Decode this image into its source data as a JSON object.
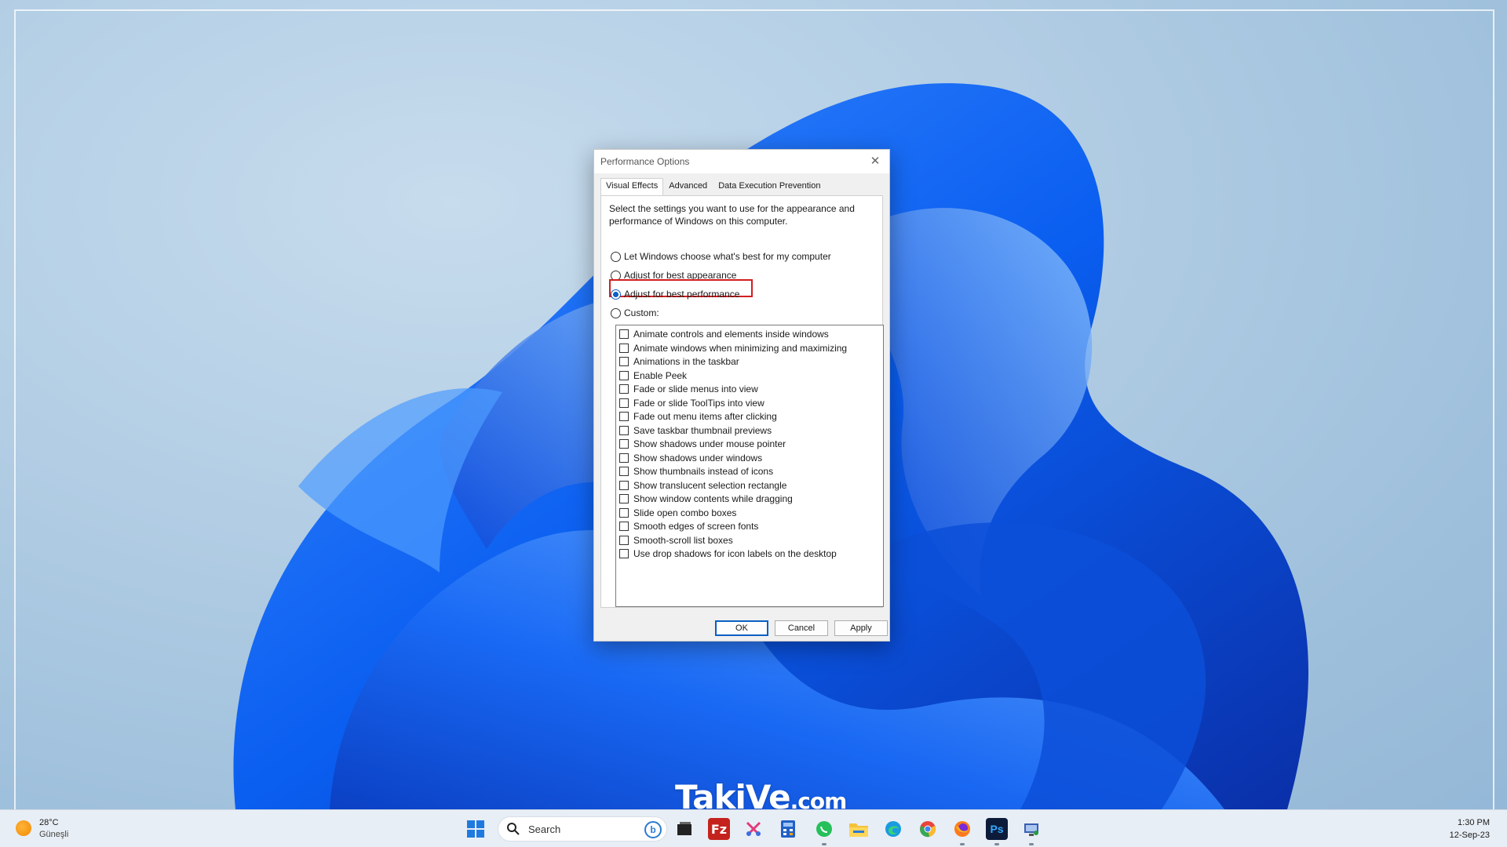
{
  "dialog": {
    "title": "Performance Options",
    "tabs": [
      {
        "label": "Visual Effects",
        "active": true
      },
      {
        "label": "Advanced",
        "active": false
      },
      {
        "label": "Data Execution Prevention",
        "active": false
      }
    ],
    "description": "Select the settings you want to use for the appearance and performance of Windows on this computer.",
    "radios": [
      {
        "label": "Let Windows choose what's best for my computer",
        "checked": false
      },
      {
        "label": "Adjust for best appearance",
        "checked": false
      },
      {
        "label": "Adjust for best performance",
        "checked": true
      },
      {
        "label": "Custom:",
        "checked": false
      }
    ],
    "effects": [
      "Animate controls and elements inside windows",
      "Animate windows when minimizing and maximizing",
      "Animations in the taskbar",
      "Enable Peek",
      "Fade or slide menus into view",
      "Fade or slide ToolTips into view",
      "Fade out menu items after clicking",
      "Save taskbar thumbnail previews",
      "Show shadows under mouse pointer",
      "Show shadows under windows",
      "Show thumbnails instead of icons",
      "Show translucent selection rectangle",
      "Show window contents while dragging",
      "Slide open combo boxes",
      "Smooth edges of screen fonts",
      "Smooth-scroll list boxes",
      "Use drop shadows for icon labels on the desktop"
    ],
    "buttons": {
      "ok": "OK",
      "cancel": "Cancel",
      "apply": "Apply"
    },
    "highlight_color": "#d21f1f"
  },
  "watermark": {
    "main": "TakiVe",
    "suffix": ".com"
  },
  "taskbar": {
    "weather": {
      "temp": "28°C",
      "condition": "Güneşli"
    },
    "search": {
      "placeholder": "Search"
    },
    "apps": [
      "start-icon",
      "search-icon",
      "bing-icon",
      "task-view-icon",
      "filezilla-icon",
      "snipping-tool-icon",
      "calculator-icon",
      "whatsapp-icon",
      "file-explorer-icon",
      "edge-icon",
      "chrome-icon",
      "firefox-icon",
      "photoshop-icon",
      "network-monitor-icon"
    ],
    "clock": {
      "time": "1:30 PM",
      "date": "12-Sep-23"
    }
  }
}
